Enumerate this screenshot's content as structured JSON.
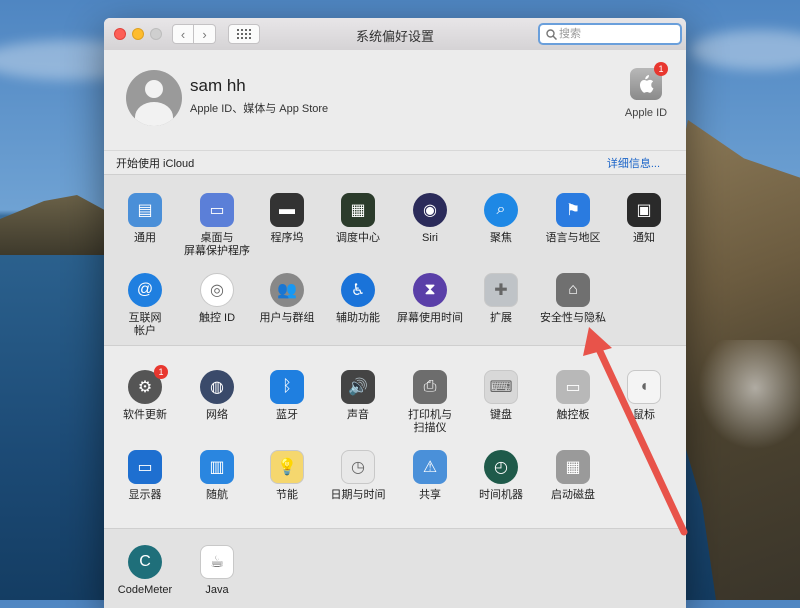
{
  "window": {
    "title": "系统偏好设置",
    "search_placeholder": "搜索"
  },
  "account": {
    "name": "sam hh",
    "subtitle": "Apple ID、媒体与 App Store",
    "apple_id_label": "Apple ID",
    "apple_id_badge": "1",
    "icloud_prompt": "开始使用 iCloud",
    "details_link": "详细信息..."
  },
  "section1": [
    {
      "label": "通用",
      "icon": "general-icon",
      "color": "#4a8fd8"
    },
    {
      "label": "桌面与\n屏幕保护程序",
      "icon": "desktop-screensaver-icon",
      "color": "#5b7fd8"
    },
    {
      "label": "程序坞",
      "icon": "dock-icon",
      "color": "#333333"
    },
    {
      "label": "调度中心",
      "icon": "mission-control-icon",
      "color": "#2b3b2b"
    },
    {
      "label": "Siri",
      "icon": "siri-icon",
      "color": "#2b2b5a"
    },
    {
      "label": "聚焦",
      "icon": "spotlight-icon",
      "color": "#1e88e5"
    },
    {
      "label": "语言与地区",
      "icon": "language-region-icon",
      "color": "#2a7be0"
    },
    {
      "label": "通知",
      "icon": "notifications-icon",
      "color": "#2a2a2a"
    },
    {
      "label": "互联网\n帐户",
      "icon": "internet-accounts-icon",
      "color": "#1f7fe0"
    },
    {
      "label": "触控 ID",
      "icon": "touch-id-icon",
      "color": "#ffffff"
    },
    {
      "label": "用户与群组",
      "icon": "users-groups-icon",
      "color": "#888888"
    },
    {
      "label": "辅助功能",
      "icon": "accessibility-icon",
      "color": "#1a73d9"
    },
    {
      "label": "屏幕使用时间",
      "icon": "screen-time-icon",
      "color": "#5a3fa8"
    },
    {
      "label": "扩展",
      "icon": "extensions-icon",
      "color": "#bfc3c7"
    },
    {
      "label": "安全性与隐私",
      "icon": "security-privacy-icon",
      "color": "#707070"
    }
  ],
  "section2": [
    {
      "label": "软件更新",
      "icon": "software-update-icon",
      "color": "#555555",
      "badge": "1"
    },
    {
      "label": "网络",
      "icon": "network-icon",
      "color": "#3a4a6a"
    },
    {
      "label": "蓝牙",
      "icon": "bluetooth-icon",
      "color": "#1f7fe0"
    },
    {
      "label": "声音",
      "icon": "sound-icon",
      "color": "#444444"
    },
    {
      "label": "打印机与\n扫描仪",
      "icon": "printers-scanners-icon",
      "color": "#6d6d6d"
    },
    {
      "label": "键盘",
      "icon": "keyboard-icon",
      "color": "#d8d8d8"
    },
    {
      "label": "触控板",
      "icon": "trackpad-icon",
      "color": "#b8b8b8"
    },
    {
      "label": "鼠标",
      "icon": "mouse-icon",
      "color": "#f4f4f4"
    },
    {
      "label": "显示器",
      "icon": "displays-icon",
      "color": "#1e6fd0"
    },
    {
      "label": "随航",
      "icon": "sidecar-icon",
      "color": "#2a86e0"
    },
    {
      "label": "节能",
      "icon": "energy-saver-icon",
      "color": "#f5d76e"
    },
    {
      "label": "日期与时间",
      "icon": "date-time-icon",
      "color": "#e8e8e8"
    },
    {
      "label": "共享",
      "icon": "sharing-icon",
      "color": "#4a90d9"
    },
    {
      "label": "时间机器",
      "icon": "time-machine-icon",
      "color": "#1f5a4a"
    },
    {
      "label": "启动磁盘",
      "icon": "startup-disk-icon",
      "color": "#9a9a9a"
    }
  ],
  "section3": [
    {
      "label": "CodeMeter",
      "icon": "codemeter-icon",
      "color": "#1f6f7a"
    },
    {
      "label": "Java",
      "icon": "java-icon",
      "color": "#ffffff"
    }
  ],
  "annotation_color": "#e8534a"
}
